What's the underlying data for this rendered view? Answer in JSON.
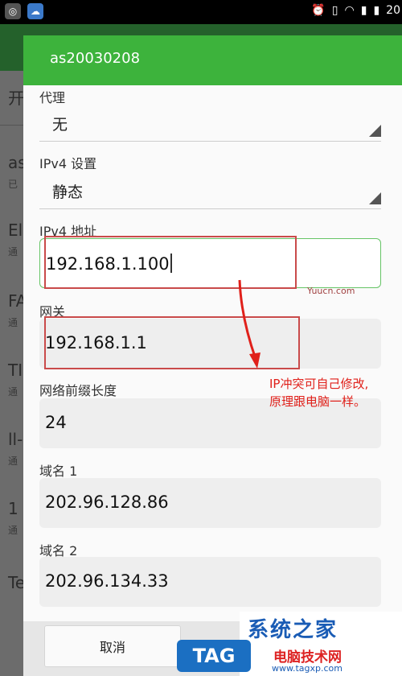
{
  "status_bar": {
    "time_partial": "20"
  },
  "background": {
    "items": [
      {
        "text": "开"
      },
      {
        "text": "as",
        "sub": "已"
      },
      {
        "text": "El",
        "sub": "通"
      },
      {
        "text": "FA",
        "sub": "通"
      },
      {
        "text": "TI",
        "sub": "通"
      },
      {
        "text": "ll-",
        "sub": "通"
      },
      {
        "text": "1",
        "sub": "通"
      },
      {
        "text": "Te"
      }
    ]
  },
  "dialog": {
    "title": "as20030208",
    "proxy": {
      "label": "代理",
      "value": "无"
    },
    "ipv4_settings": {
      "label": "IPv4 设置",
      "value": "静态"
    },
    "ipv4_address": {
      "label": "IPv4 地址",
      "value": "192.168.1.100"
    },
    "gateway": {
      "label": "网关",
      "value": "192.168.1.1"
    },
    "prefix_length": {
      "label": "网络前缀长度",
      "value": "24"
    },
    "dns1": {
      "label": "域名 1",
      "value": "202.96.128.86"
    },
    "dns2": {
      "label": "域名 2",
      "value": "202.96.134.33"
    },
    "cancel_label": "取消"
  },
  "annotation": {
    "line1": "IP冲突可自己修改,",
    "line2": "原理跟电脑一样。",
    "color": "#e0201a"
  },
  "watermark": {
    "site": "Yuucn.com",
    "logo": "系统之家",
    "subtitle": "电脑技术网",
    "url": "www.tagxp.com",
    "tag": "TAG"
  },
  "colors": {
    "accent": "#3db33c",
    "annotation_box": "#c94a4a"
  }
}
